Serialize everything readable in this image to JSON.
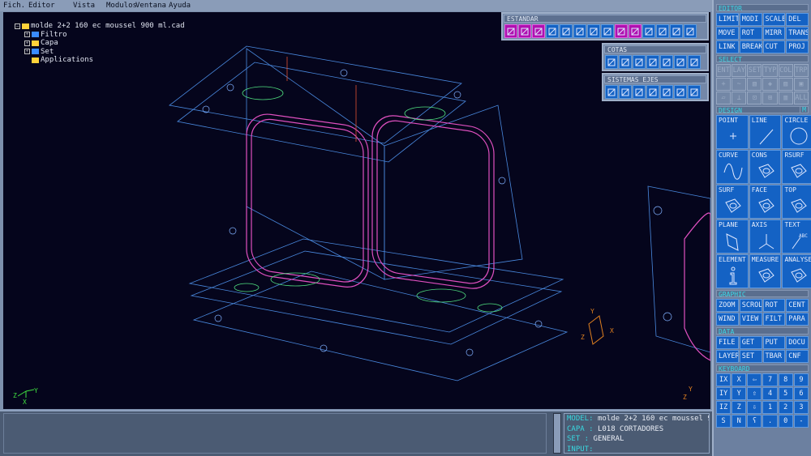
{
  "menu": [
    "Fich.",
    "Editor",
    "Vista",
    "Modulos",
    "Ventana",
    "Ayuda"
  ],
  "tree": {
    "root": "molde 2+2 160 ec moussel 900 ml.cad",
    "children": [
      {
        "label": "Filtro",
        "color": "#3a8cff"
      },
      {
        "label": "Capa",
        "color": "#ffd23a"
      },
      {
        "label": "Set",
        "color": "#3a8cff"
      },
      {
        "label": "Applications",
        "color": "#ffd23a"
      }
    ]
  },
  "toolbars": {
    "estandar": {
      "title": "ESTANDAR",
      "icons": [
        "wire-cube-icon",
        "shaded-cube-icon",
        "hidden-cube-icon",
        "regenerate-icon",
        "zoom-icon",
        "pan-icon",
        "axes-icon",
        "rotate-view-icon",
        "grid-icon",
        "snap-icon",
        "lamp-icon",
        "undo-icon",
        "redo-icon",
        "help-cursor-icon"
      ]
    },
    "cotas": {
      "title": "COTAS",
      "icons": [
        "info-icon",
        "dim-xy-icon",
        "dim-linear-icon",
        "dim-aligned-icon",
        "dim-circle-icon",
        "dim-angle-icon",
        "dim-box-icon"
      ]
    },
    "ejes": {
      "title": "SISTEMAS EJES",
      "icons": [
        "axis-yx-icon",
        "axis-zx-icon",
        "axis-zx2-icon",
        "axis-yx2-icon",
        "axis-xz-icon",
        "axis-xz2-icon",
        "axis-plain-icon"
      ]
    }
  },
  "panel": {
    "editor": {
      "title": "EDITOR",
      "buttons": [
        "LIMIT",
        "MODI",
        "SCALE",
        "DEL",
        "MOVE",
        "ROT",
        "MIRR",
        "TRANS",
        "LINK",
        "BREAK",
        "CUT",
        "PROJ"
      ]
    },
    "select": {
      "title": "SELECT",
      "buttons": [
        "ENT",
        "LAY",
        "SET",
        "TYP",
        "COL",
        "TRP"
      ],
      "row2": [
        "+",
        "~",
        "▧",
        "◈",
        "▨",
        "▣"
      ],
      "row3": [
        "▱",
        "⊥",
        "⊡",
        "⊞",
        "▥",
        "ALL"
      ]
    },
    "design": {
      "title": "DESIGN",
      "m": "M",
      "buttons": [
        "POINT",
        "LINE",
        "CIRCLE",
        "CURVE",
        "CONS",
        "RSURF",
        "SURF",
        "FACE",
        "TOP",
        "PLANE",
        "AXIS",
        "TEXT",
        "ELEMENT",
        "MEASURE",
        "ANALYSE"
      ]
    },
    "graphic": {
      "title": "GRAPHIC",
      "buttons": [
        "ZOOM",
        "SCROL",
        "ROT",
        "CENT",
        "WIND",
        "VIEW",
        "FILT",
        "PARA"
      ]
    },
    "data": {
      "title": "DATA",
      "buttons": [
        "FILE",
        "GET",
        "PUT",
        "DOCU",
        "LAYER",
        "SET",
        "TBAR",
        "CNF"
      ]
    },
    "keyboard": {
      "title": "KEYBOARD",
      "keys": [
        "IX",
        "X",
        "⇦",
        "7",
        "8",
        "9",
        "IY",
        "Y",
        "⇧",
        "4",
        "5",
        "6",
        "IZ",
        "Z",
        "⇩",
        "1",
        "2",
        "3",
        "S",
        "N",
        "ʕ",
        ".",
        "0",
        "-"
      ]
    }
  },
  "status": {
    "model_label": "MODEL",
    "model": "molde 2+2 160 ec moussel 9",
    "capa_label": "CAPA",
    "capa": "L018 CORTADORES",
    "set_label": "SET",
    "set": "GENERAL",
    "input_label": "INPUT"
  },
  "colors": {
    "viewport": "#05051c",
    "button": "#1462c4",
    "active": "#b010b0",
    "heading": "#3ad8e6"
  }
}
